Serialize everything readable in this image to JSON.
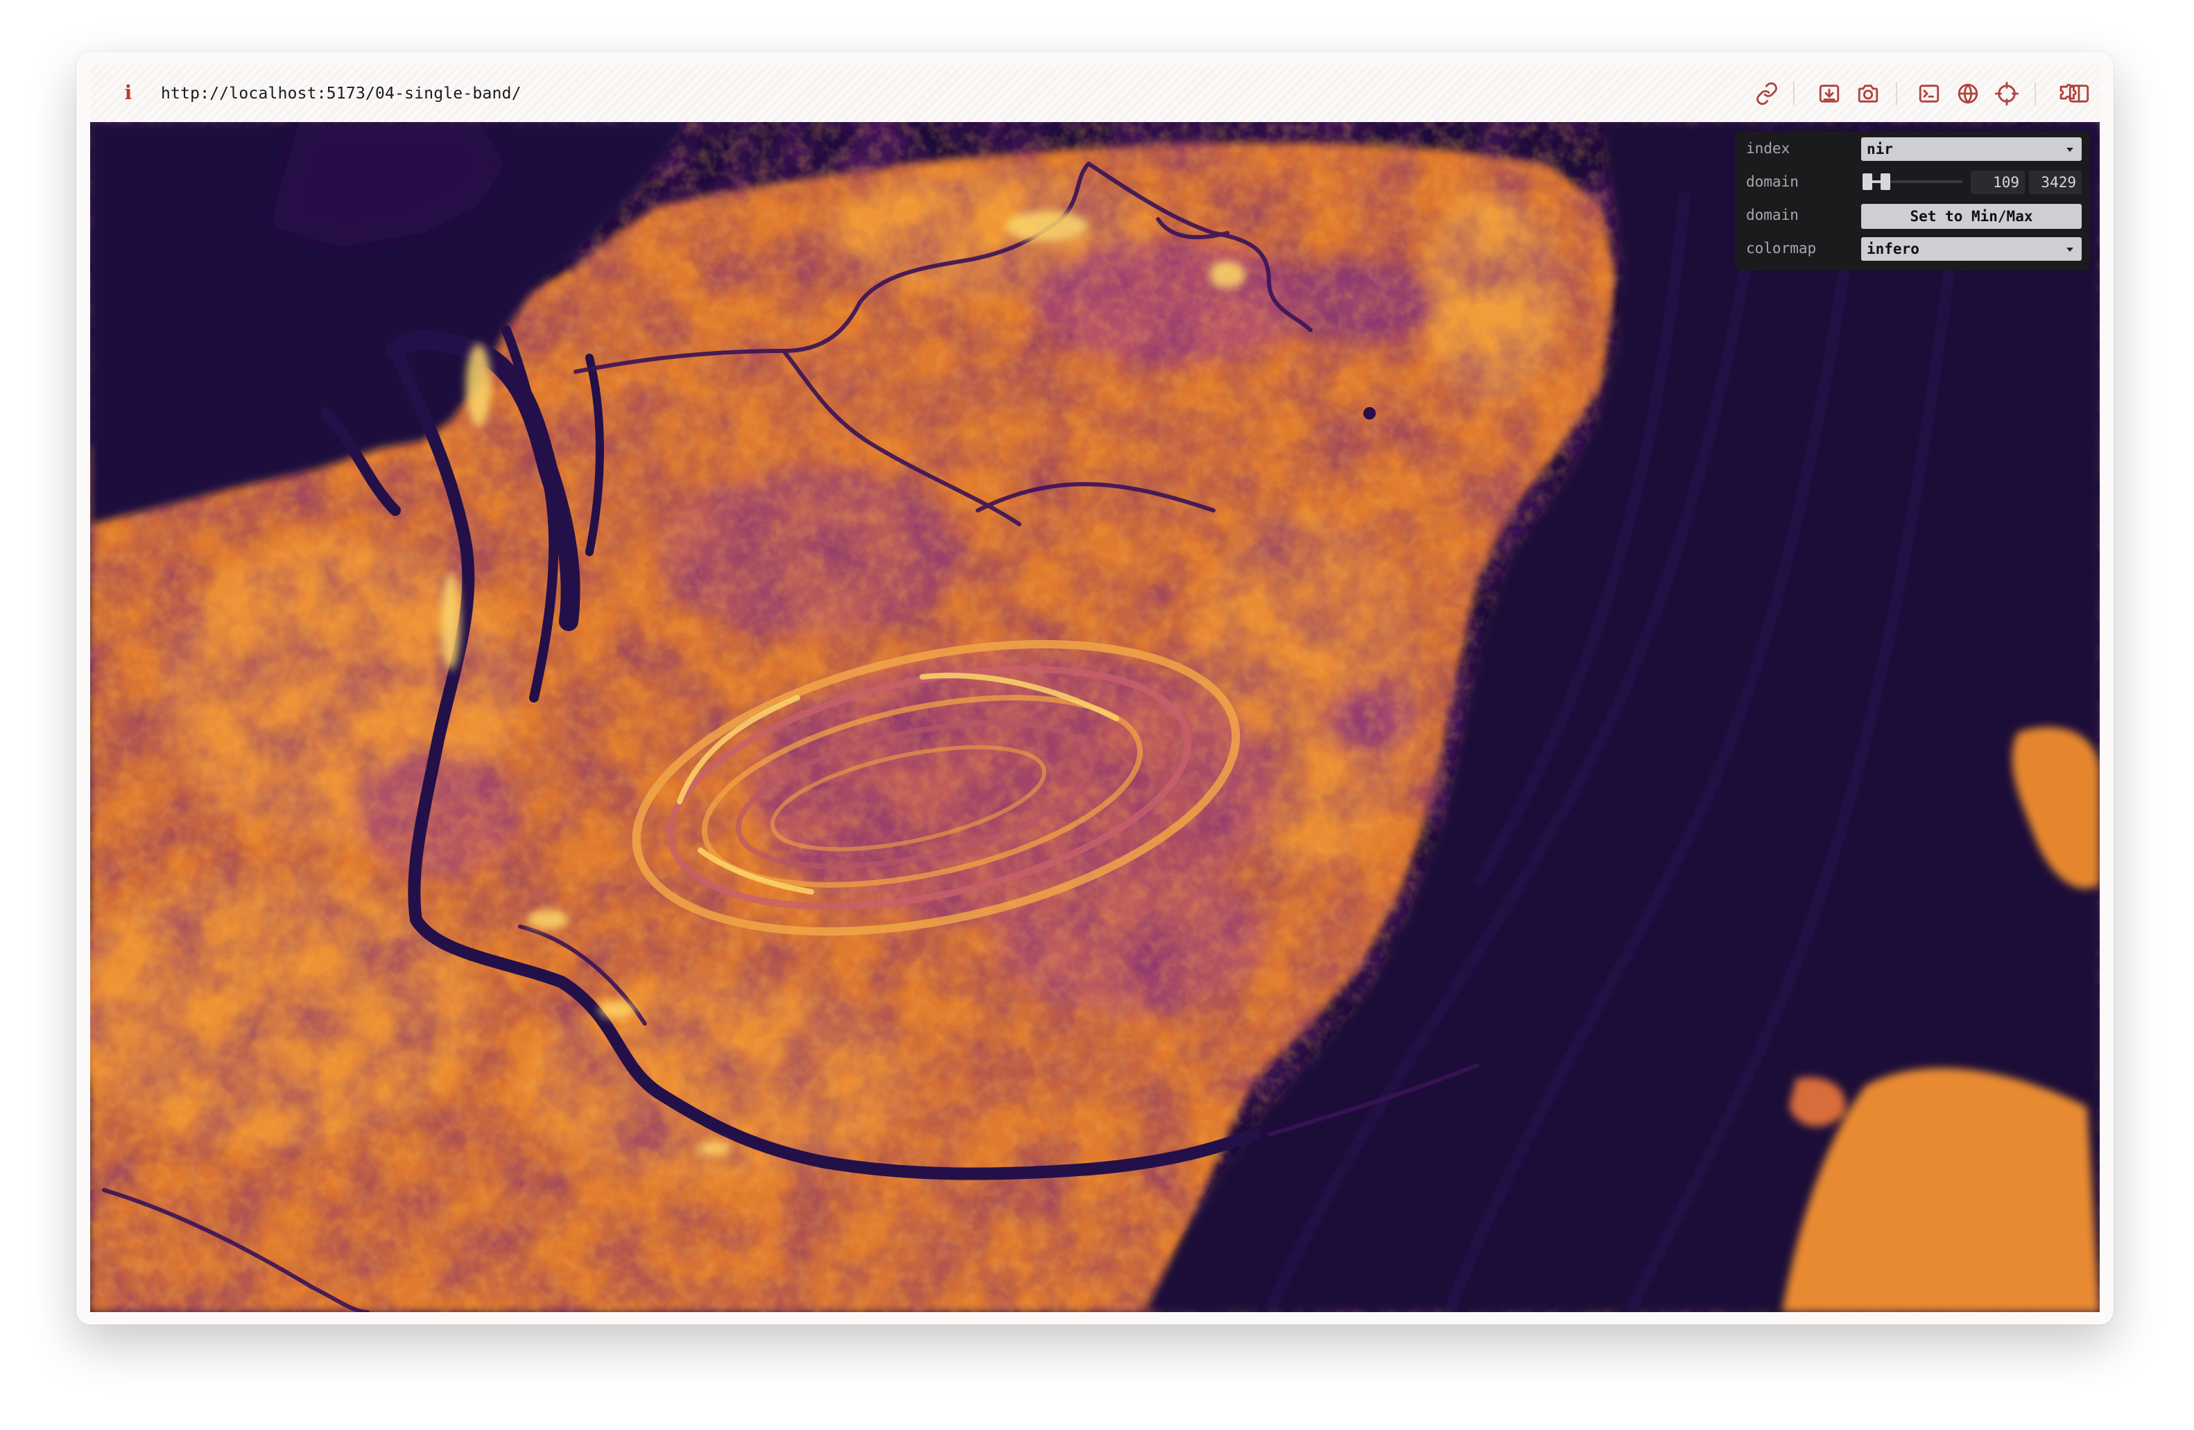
{
  "browser": {
    "url": "http://localhost:5173/04-single-band/",
    "info_icon": "i",
    "toolbar_icons": [
      "link-icon",
      "download-icon",
      "camera-icon",
      "terminal-icon",
      "globe-icon",
      "crosshair-icon",
      "extension-icon",
      "split-view-icon"
    ]
  },
  "map": {
    "description_icon": "raster-map",
    "colormap_colors": [
      "#1a0b3e",
      "#3b0f70",
      "#6a1b8a",
      "#a63a86",
      "#d45f52",
      "#e8832e",
      "#f5a23f",
      "#fcd56a"
    ]
  },
  "gui": {
    "index": {
      "label": "index",
      "value": "nir"
    },
    "domain_range": {
      "label": "domain",
      "min_value": "109",
      "max_value": "3429",
      "min_fraction": 0.0,
      "max_fraction": 0.2
    },
    "domain_button": {
      "label": "domain",
      "button_label": "Set to Min/Max"
    },
    "colormap": {
      "label": "colormap",
      "value": "infero"
    }
  }
}
